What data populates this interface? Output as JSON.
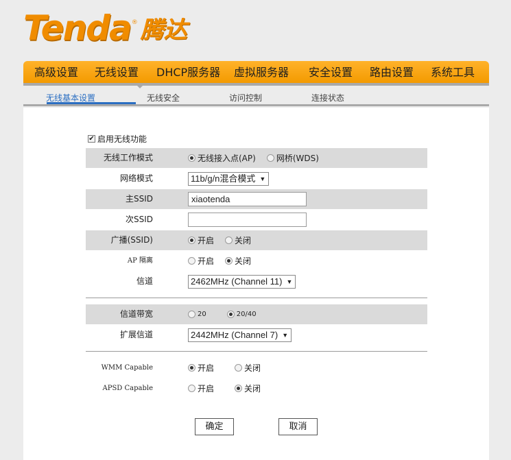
{
  "logo": {
    "brand": "Tenda",
    "reg": "®",
    "cn": "腾达"
  },
  "main_nav": [
    "高级设置",
    "无线设置",
    "DHCP服务器",
    "虚拟服务器",
    "安全设置",
    "路由设置",
    "系统工具"
  ],
  "sub_nav": [
    "无线基本设置",
    "无线安全",
    "访问控制",
    "连接状态"
  ],
  "form": {
    "enable_wireless": "启用无线功能",
    "work_mode": {
      "label": "无线工作模式",
      "opt1": "无线接入点(AP)",
      "opt2": "网桥(WDS)"
    },
    "net_mode": {
      "label": "网络模式",
      "value": "11b/g/n混合模式"
    },
    "primary_ssid": {
      "label": "主SSID",
      "value": "xiaotenda"
    },
    "secondary_ssid": {
      "label": "次SSID",
      "value": ""
    },
    "broadcast": {
      "label": "广播(SSID)",
      "on": "开启",
      "off": "关闭"
    },
    "ap_isolation": {
      "label": "AP 隔离",
      "on": "开启",
      "off": "关闭"
    },
    "channel": {
      "label": "信道",
      "value": "2462MHz (Channel 11)"
    },
    "bandwidth": {
      "label": "信道带宽",
      "opt1": "20",
      "opt2": "20/40"
    },
    "ext_channel": {
      "label": "扩展信道",
      "value": "2442MHz (Channel 7)"
    },
    "wmm": {
      "label": "WMM Capable",
      "on": "开启",
      "off": "关闭"
    },
    "apsd": {
      "label": "APSD Capable",
      "on": "开启",
      "off": "关闭"
    }
  },
  "buttons": {
    "ok": "确定",
    "cancel": "取消"
  },
  "colors": {
    "accent": "#f39a00",
    "active_tab": "#2a6ec2",
    "row_shade": "#dadada"
  }
}
